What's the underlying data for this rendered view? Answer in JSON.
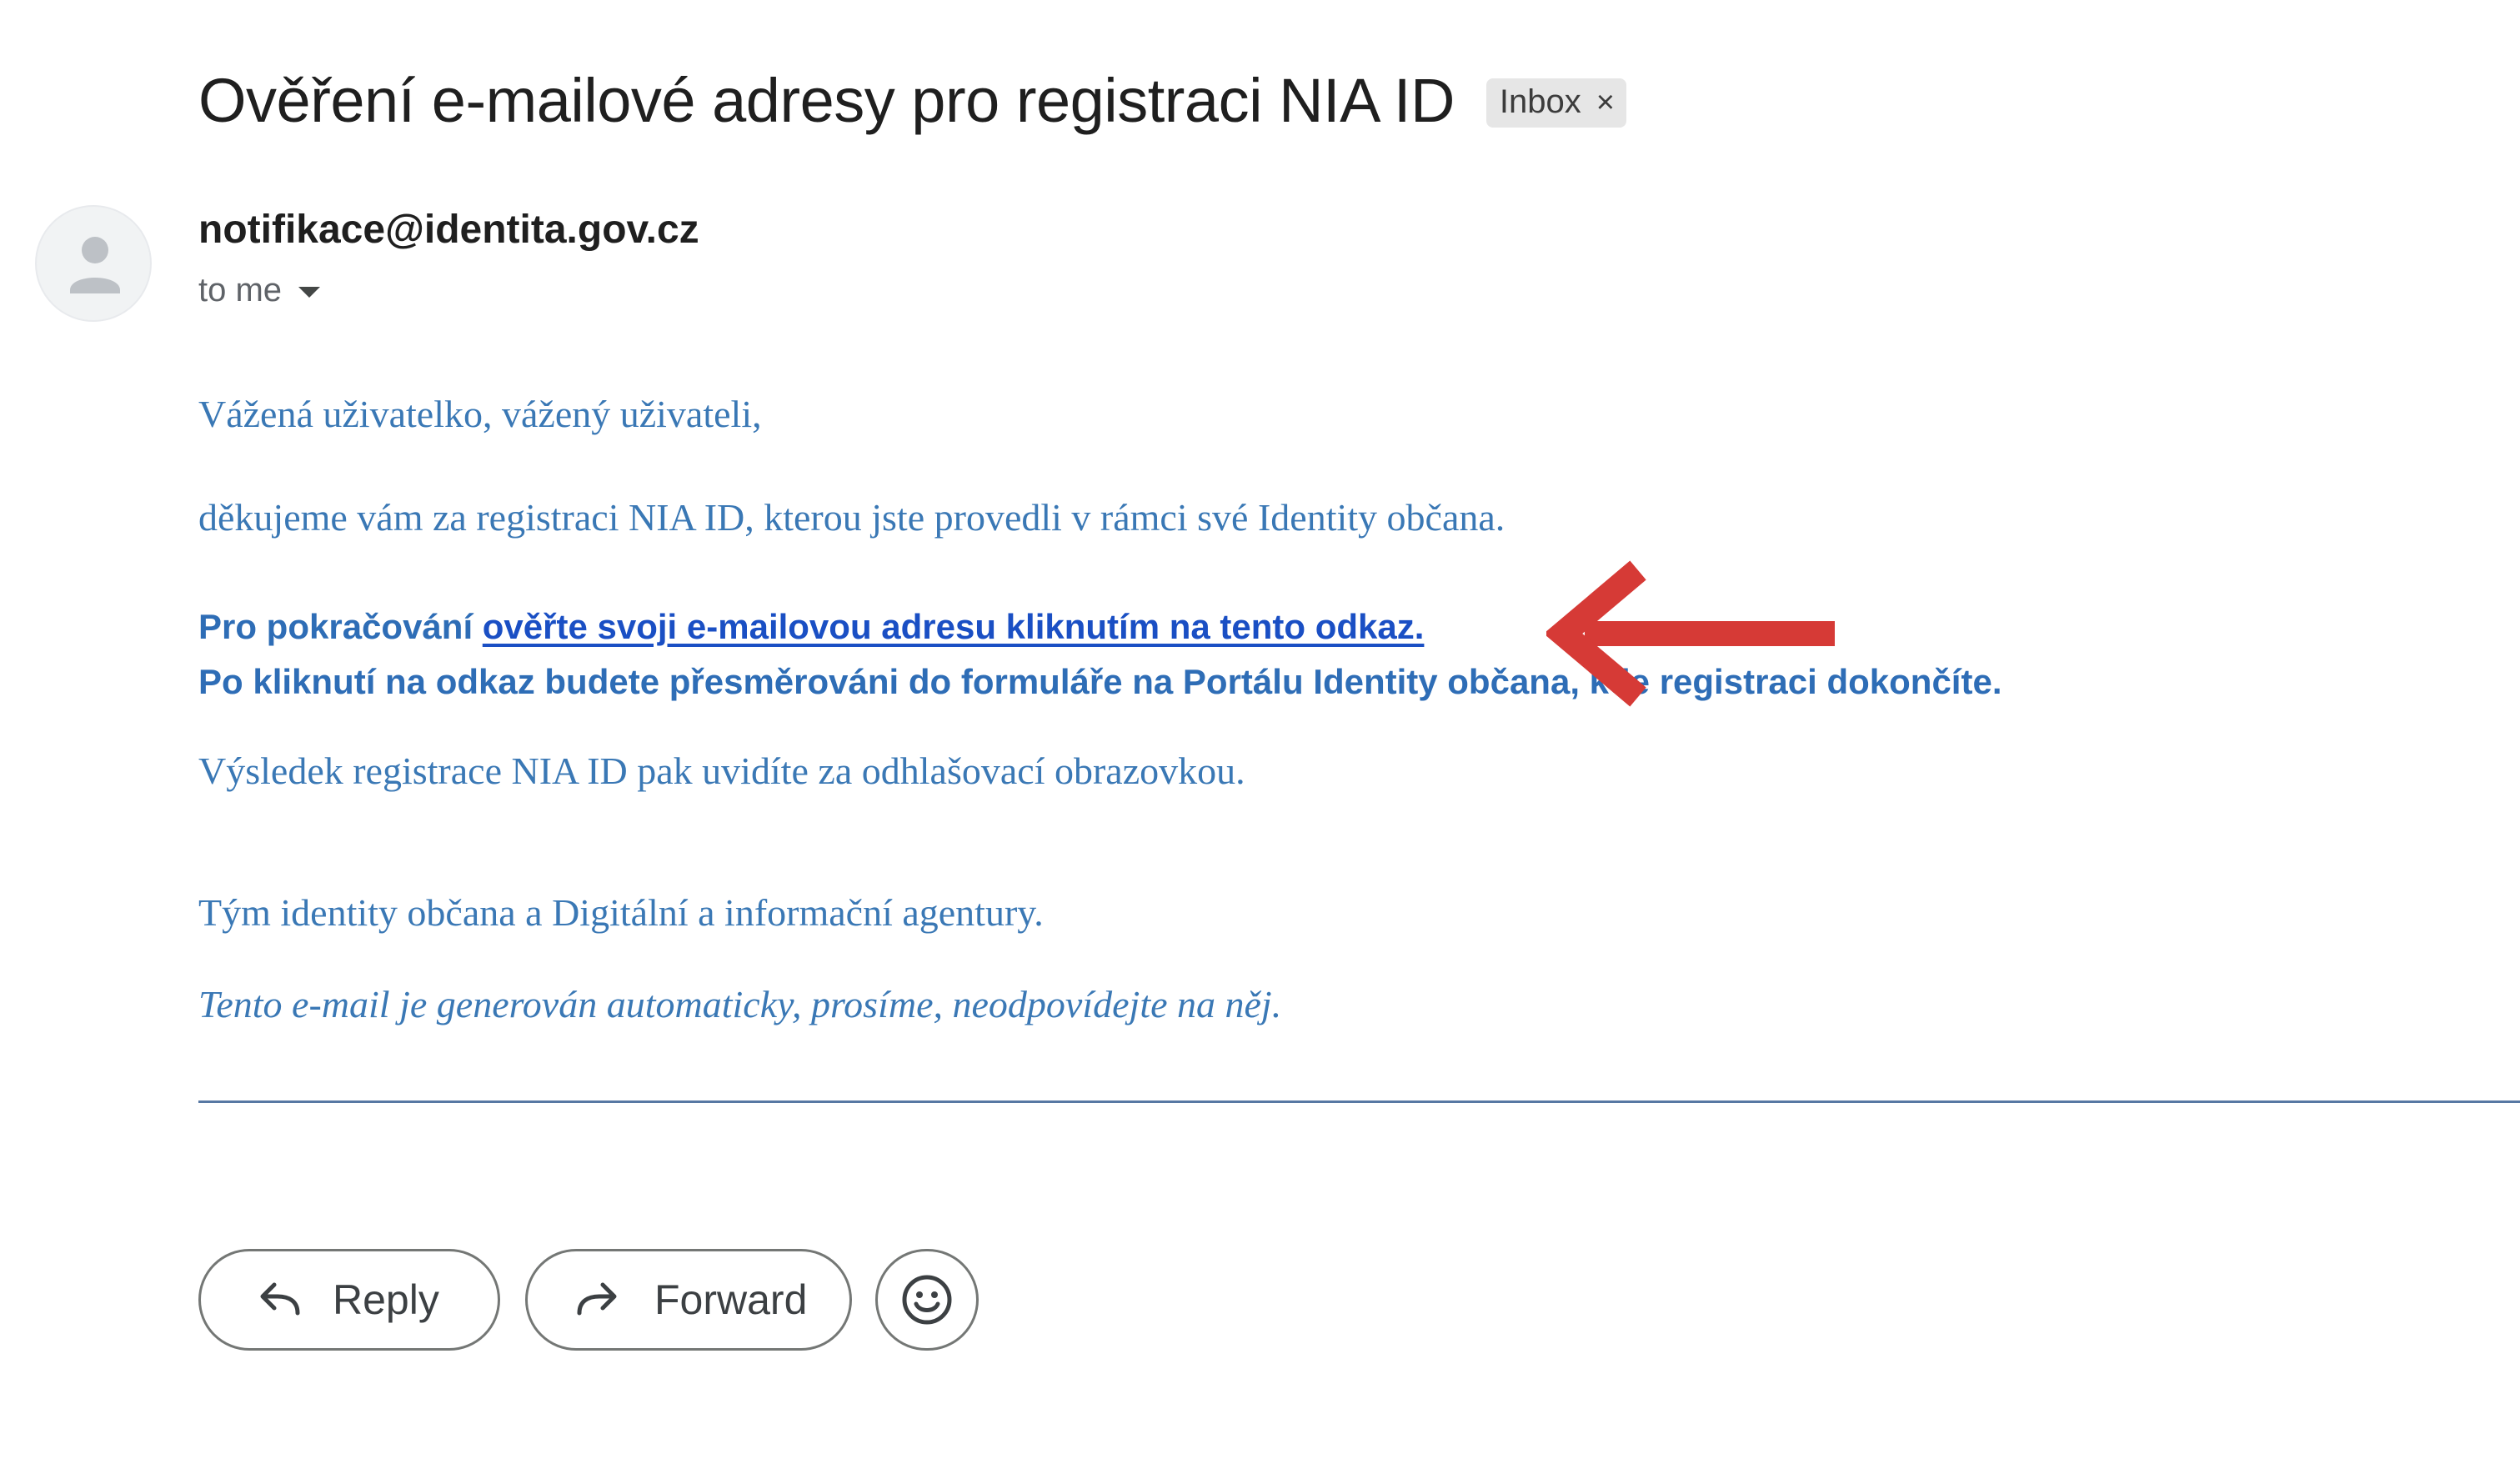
{
  "email": {
    "subject": "Ověření e-mailové adresy pro registraci NIA ID",
    "label": {
      "text": "Inbox",
      "close_glyph": "×"
    },
    "sender": "notifikace@identita.gov.cz",
    "recipient": "to me",
    "avatar_icon": "person-icon"
  },
  "body": {
    "greeting": "Vážená uživatelko, vážený uživateli,",
    "thanks": "děkujeme vám za registraci NIA ID, kterou jste provedli v rámci své Identity občana.",
    "continue_prefix": "Pro pokračování ",
    "verify_link": "ověřte svoji e-mailovou adresu kliknutím na tento odkaz.",
    "redirect_note": "Po kliknutí na odkaz budete přesměrováni do formuláře na Portálu Identity občana, kde registraci dokončíte.",
    "result_note": "Výsledek registrace NIA ID pak uvidíte za odhlašovací obrazovkou.",
    "signature": "Tým identity občana a Digitální a informační agentury.",
    "auto_notice": "Tento e-mail je generován automaticky, prosíme, neodpovídejte na něj."
  },
  "annotation": {
    "arrow_color": "#d63a36",
    "icon": "red-arrow-icon"
  },
  "actions": {
    "reply_label": "Reply",
    "forward_label": "Forward",
    "reply_icon": "reply-icon",
    "forward_icon": "forward-icon",
    "emoji_icon": "emoji-smile-icon"
  },
  "colors": {
    "body_text": "#3a78b5",
    "link": "#1a4fc4",
    "divider": "#5778a3"
  }
}
